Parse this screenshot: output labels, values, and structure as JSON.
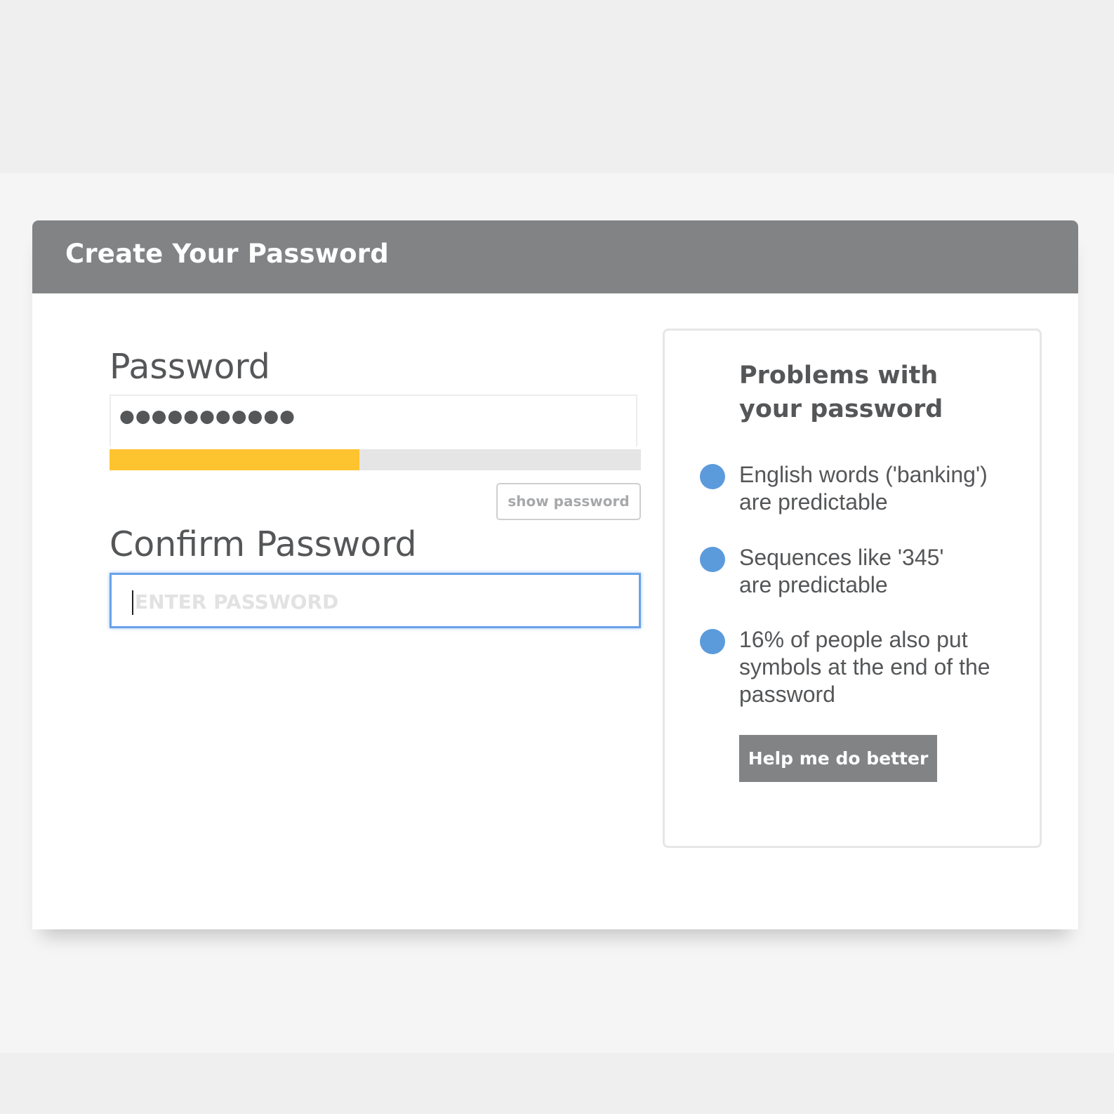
{
  "dialog": {
    "title": "Create Your Password"
  },
  "password": {
    "label": "Password",
    "masked_value": "●●●●●●●●●●●",
    "strength_fraction": 0.47,
    "strength_color": "#fec42f",
    "show_label": "show password"
  },
  "confirm": {
    "label": "Confirm Password",
    "placeholder": "ENTER PASSWORD"
  },
  "problems": {
    "title_lines": [
      "Problems with",
      "your password"
    ],
    "items": [
      {
        "lines": [
          "English words ('banking')",
          "are predictable"
        ]
      },
      {
        "lines": [
          "Sequences like '345'",
          "are predictable"
        ]
      },
      {
        "lines": [
          "16% of people also put",
          "symbols at the end of the",
          "password"
        ]
      }
    ],
    "bullet_color": "#5b9bdc",
    "help_label": "Help me do better"
  },
  "colors": {
    "header": "#828385",
    "focus_border": "#6aa3e8",
    "text": "#555658"
  }
}
